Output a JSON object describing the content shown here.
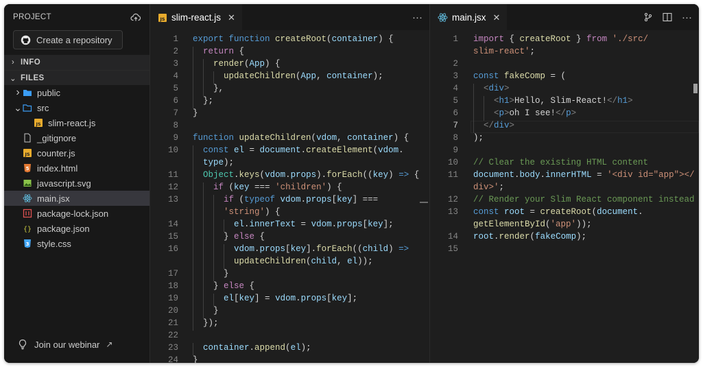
{
  "sidebar": {
    "title": "PROJECT",
    "repo_button": "Create a repository",
    "sections": {
      "info": "INFO",
      "files": "FILES"
    },
    "files": [
      {
        "label": "public",
        "kind": "folder",
        "indent": 0,
        "twisty": ">"
      },
      {
        "label": "src",
        "kind": "folder-open",
        "indent": 0,
        "twisty": "v"
      },
      {
        "label": "slim-react.js",
        "kind": "js",
        "indent": 1
      },
      {
        "label": "_gitignore",
        "kind": "file",
        "indent": 0
      },
      {
        "label": "counter.js",
        "kind": "js",
        "indent": 0
      },
      {
        "label": "index.html",
        "kind": "html",
        "indent": 0
      },
      {
        "label": "javascript.svg",
        "kind": "image",
        "indent": 0
      },
      {
        "label": "main.jsx",
        "kind": "react",
        "indent": 0,
        "active": true
      },
      {
        "label": "package-lock.json",
        "kind": "lock",
        "indent": 0
      },
      {
        "label": "package.json",
        "kind": "json",
        "indent": 0
      },
      {
        "label": "style.css",
        "kind": "css",
        "indent": 0
      }
    ],
    "webinar": "Join our webinar"
  },
  "editor_left": {
    "tab": {
      "label": "slim-react.js",
      "close": "✕",
      "icon": "js-file-icon"
    },
    "more": "···",
    "lines": [
      {
        "n": "1",
        "indent": 0,
        "tokens": [
          [
            "kw",
            "export "
          ],
          [
            "kw",
            "function "
          ],
          [
            "fn",
            "createRoot"
          ],
          [
            "pl",
            "("
          ],
          [
            "var",
            "container"
          ],
          [
            "pl",
            ") {"
          ]
        ]
      },
      {
        "n": "2",
        "indent": 1,
        "tokens": [
          [
            "ctl",
            "return "
          ],
          [
            "pl",
            "{"
          ]
        ]
      },
      {
        "n": "3",
        "indent": 2,
        "tokens": [
          [
            "fn",
            "render"
          ],
          [
            "pl",
            "("
          ],
          [
            "var",
            "App"
          ],
          [
            "pl",
            ") {"
          ]
        ]
      },
      {
        "n": "4",
        "indent": 3,
        "tokens": [
          [
            "fn",
            "updateChildren"
          ],
          [
            "pl",
            "("
          ],
          [
            "var",
            "App"
          ],
          [
            "pl",
            ", "
          ],
          [
            "var",
            "container"
          ],
          [
            "pl",
            ");"
          ]
        ]
      },
      {
        "n": "5",
        "indent": 2,
        "tokens": [
          [
            "pl",
            "},"
          ]
        ]
      },
      {
        "n": "6",
        "indent": 1,
        "tokens": [
          [
            "pl",
            "};"
          ]
        ]
      },
      {
        "n": "7",
        "indent": 0,
        "tokens": [
          [
            "pl",
            "}"
          ]
        ]
      },
      {
        "n": "8",
        "indent": 0,
        "tokens": []
      },
      {
        "n": "9",
        "indent": 0,
        "tokens": [
          [
            "kw",
            "function "
          ],
          [
            "fn",
            "updateChildren"
          ],
          [
            "pl",
            "("
          ],
          [
            "var",
            "vdom"
          ],
          [
            "pl",
            ", "
          ],
          [
            "var",
            "container"
          ],
          [
            "pl",
            ") {"
          ]
        ]
      },
      {
        "n": "10",
        "indent": 1,
        "tokens": [
          [
            "kw",
            "const "
          ],
          [
            "var",
            "el"
          ],
          [
            "pl",
            " = "
          ],
          [
            "var",
            "document"
          ],
          [
            "pl",
            "."
          ],
          [
            "fn",
            "createElement"
          ],
          [
            "pl",
            "("
          ],
          [
            "var",
            "vdom"
          ],
          [
            "pl",
            "."
          ]
        ]
      },
      {
        "n": "",
        "indent": 1,
        "tokens": [
          [
            "var",
            "type"
          ],
          [
            "pl",
            ");"
          ]
        ]
      },
      {
        "n": "11",
        "indent": 1,
        "tokens": [
          [
            "cls",
            "Object"
          ],
          [
            "pl",
            "."
          ],
          [
            "fn",
            "keys"
          ],
          [
            "pl",
            "("
          ],
          [
            "var",
            "vdom"
          ],
          [
            "pl",
            "."
          ],
          [
            "var",
            "props"
          ],
          [
            "pl",
            ")."
          ],
          [
            "fn",
            "forEach"
          ],
          [
            "pl",
            "(("
          ],
          [
            "var",
            "key"
          ],
          [
            "pl",
            ") "
          ],
          [
            "kw",
            "=>"
          ],
          [
            "pl",
            " {"
          ]
        ]
      },
      {
        "n": "12",
        "indent": 2,
        "tokens": [
          [
            "ctl",
            "if "
          ],
          [
            "pl",
            "("
          ],
          [
            "var",
            "key"
          ],
          [
            "pl",
            " === "
          ],
          [
            "str",
            "'children'"
          ],
          [
            "pl",
            ") {"
          ]
        ]
      },
      {
        "n": "13",
        "indent": 3,
        "tokens": [
          [
            "ctl",
            "if "
          ],
          [
            "pl",
            "("
          ],
          [
            "kw",
            "typeof "
          ],
          [
            "var",
            "vdom"
          ],
          [
            "pl",
            "."
          ],
          [
            "var",
            "props"
          ],
          [
            "pl",
            "["
          ],
          [
            "var",
            "key"
          ],
          [
            "pl",
            "] ==="
          ]
        ]
      },
      {
        "n": "",
        "indent": 3,
        "tokens": [
          [
            "str",
            "'string'"
          ],
          [
            "pl",
            ") {"
          ]
        ]
      },
      {
        "n": "14",
        "indent": 4,
        "tokens": [
          [
            "var",
            "el"
          ],
          [
            "pl",
            "."
          ],
          [
            "var",
            "innerText"
          ],
          [
            "pl",
            " = "
          ],
          [
            "var",
            "vdom"
          ],
          [
            "pl",
            "."
          ],
          [
            "var",
            "props"
          ],
          [
            "pl",
            "["
          ],
          [
            "var",
            "key"
          ],
          [
            "pl",
            "];"
          ]
        ]
      },
      {
        "n": "15",
        "indent": 3,
        "tokens": [
          [
            "pl",
            "} "
          ],
          [
            "ctl",
            "else "
          ],
          [
            "pl",
            "{"
          ]
        ]
      },
      {
        "n": "16",
        "indent": 4,
        "tokens": [
          [
            "var",
            "vdom"
          ],
          [
            "pl",
            "."
          ],
          [
            "var",
            "props"
          ],
          [
            "pl",
            "["
          ],
          [
            "var",
            "key"
          ],
          [
            "pl",
            "]."
          ],
          [
            "fn",
            "forEach"
          ],
          [
            "pl",
            "(("
          ],
          [
            "var",
            "child"
          ],
          [
            "pl",
            ") "
          ],
          [
            "kw",
            "=>"
          ]
        ]
      },
      {
        "n": "",
        "indent": 4,
        "tokens": [
          [
            "fn",
            "updateChildren"
          ],
          [
            "pl",
            "("
          ],
          [
            "var",
            "child"
          ],
          [
            "pl",
            ", "
          ],
          [
            "var",
            "el"
          ],
          [
            "pl",
            "));"
          ]
        ]
      },
      {
        "n": "17",
        "indent": 3,
        "tokens": [
          [
            "pl",
            "}"
          ]
        ]
      },
      {
        "n": "18",
        "indent": 2,
        "tokens": [
          [
            "pl",
            "} "
          ],
          [
            "ctl",
            "else "
          ],
          [
            "pl",
            "{"
          ]
        ]
      },
      {
        "n": "19",
        "indent": 3,
        "tokens": [
          [
            "var",
            "el"
          ],
          [
            "pl",
            "["
          ],
          [
            "var",
            "key"
          ],
          [
            "pl",
            "] = "
          ],
          [
            "var",
            "vdom"
          ],
          [
            "pl",
            "."
          ],
          [
            "var",
            "props"
          ],
          [
            "pl",
            "["
          ],
          [
            "var",
            "key"
          ],
          [
            "pl",
            "];"
          ]
        ]
      },
      {
        "n": "20",
        "indent": 2,
        "tokens": [
          [
            "pl",
            "}"
          ]
        ]
      },
      {
        "n": "21",
        "indent": 1,
        "tokens": [
          [
            "pl",
            "});"
          ]
        ]
      },
      {
        "n": "22",
        "indent": 0,
        "tokens": []
      },
      {
        "n": "23",
        "indent": 1,
        "tokens": [
          [
            "var",
            "container"
          ],
          [
            "pl",
            "."
          ],
          [
            "fn",
            "append"
          ],
          [
            "pl",
            "("
          ],
          [
            "var",
            "el"
          ],
          [
            "pl",
            ");"
          ]
        ]
      },
      {
        "n": "24",
        "indent": 0,
        "tokens": [
          [
            "pl",
            "}"
          ]
        ]
      }
    ]
  },
  "editor_right": {
    "tab": {
      "label": "main.jsx",
      "close": "✕",
      "icon": "react-file-icon"
    },
    "more": "···",
    "current_line": "7",
    "lines": [
      {
        "n": "1",
        "indent": 0,
        "tokens": [
          [
            "ctl",
            "import "
          ],
          [
            "pl",
            "{ "
          ],
          [
            "fn",
            "createRoot"
          ],
          [
            "pl",
            " } "
          ],
          [
            "ctl",
            "from "
          ],
          [
            "str",
            "'./src/"
          ]
        ]
      },
      {
        "n": "",
        "indent": 0,
        "tokens": [
          [
            "str",
            "slim-react'"
          ],
          [
            "pl",
            ";"
          ]
        ]
      },
      {
        "n": "2",
        "indent": 0,
        "tokens": []
      },
      {
        "n": "3",
        "indent": 0,
        "tokens": [
          [
            "kw",
            "const "
          ],
          [
            "fn",
            "fakeComp"
          ],
          [
            "pl",
            " = ("
          ]
        ]
      },
      {
        "n": "4",
        "indent": 1,
        "tokens": [
          [
            "br",
            "<"
          ],
          [
            "tag",
            "div"
          ],
          [
            "br",
            ">"
          ]
        ]
      },
      {
        "n": "5",
        "indent": 2,
        "tokens": [
          [
            "br",
            "<"
          ],
          [
            "tag",
            "h1"
          ],
          [
            "br",
            ">"
          ],
          [
            "pl",
            "Hello, Slim-React!"
          ],
          [
            "br",
            "</"
          ],
          [
            "tag",
            "h1"
          ],
          [
            "br",
            ">"
          ]
        ]
      },
      {
        "n": "6",
        "indent": 2,
        "tokens": [
          [
            "br",
            "<"
          ],
          [
            "tag",
            "p"
          ],
          [
            "br",
            ">"
          ],
          [
            "pl",
            "oh I see!"
          ],
          [
            "br",
            "</"
          ],
          [
            "tag",
            "p"
          ],
          [
            "br",
            ">"
          ]
        ]
      },
      {
        "n": "7",
        "indent": 1,
        "tokens": [
          [
            "br",
            "</"
          ],
          [
            "tag",
            "div"
          ],
          [
            "br",
            ">"
          ]
        ]
      },
      {
        "n": "8",
        "indent": 0,
        "tokens": [
          [
            "pl",
            ");"
          ]
        ]
      },
      {
        "n": "9",
        "indent": 0,
        "tokens": []
      },
      {
        "n": "10",
        "indent": 0,
        "tokens": [
          [
            "cm",
            "// Clear the existing HTML content"
          ]
        ]
      },
      {
        "n": "11",
        "indent": 0,
        "tokens": [
          [
            "var",
            "document"
          ],
          [
            "pl",
            "."
          ],
          [
            "var",
            "body"
          ],
          [
            "pl",
            "."
          ],
          [
            "var",
            "innerHTML"
          ],
          [
            "pl",
            " = "
          ],
          [
            "str",
            "'<div id=\"app\"></"
          ]
        ]
      },
      {
        "n": "",
        "indent": 0,
        "tokens": [
          [
            "str",
            "div>'"
          ],
          [
            "pl",
            ";"
          ]
        ]
      },
      {
        "n": "12",
        "indent": 0,
        "tokens": [
          [
            "cm",
            "// Render your Slim React component instead"
          ]
        ]
      },
      {
        "n": "13",
        "indent": 0,
        "tokens": [
          [
            "kw",
            "const "
          ],
          [
            "var",
            "root"
          ],
          [
            "pl",
            " = "
          ],
          [
            "fn",
            "createRoot"
          ],
          [
            "pl",
            "("
          ],
          [
            "var",
            "document"
          ],
          [
            "pl",
            "."
          ]
        ]
      },
      {
        "n": "",
        "indent": 0,
        "tokens": [
          [
            "fn",
            "getElementById"
          ],
          [
            "pl",
            "("
          ],
          [
            "str",
            "'app'"
          ],
          [
            "pl",
            "));"
          ]
        ]
      },
      {
        "n": "14",
        "indent": 0,
        "tokens": [
          [
            "var",
            "root"
          ],
          [
            "pl",
            "."
          ],
          [
            "fn",
            "render"
          ],
          [
            "pl",
            "("
          ],
          [
            "var",
            "fakeComp"
          ],
          [
            "pl",
            ");"
          ]
        ]
      },
      {
        "n": "15",
        "indent": 0,
        "tokens": []
      }
    ]
  },
  "colors": {
    "js_badge": "#e8ab2d",
    "folder_blue": "#3b9cf3",
    "react_blue": "#5fb8d9",
    "html_orange": "#e37933",
    "css_blue": "#42a5f5",
    "json_yellow": "#cbcb41",
    "lock_red": "#e05252",
    "image_green": "#8bc34a"
  }
}
